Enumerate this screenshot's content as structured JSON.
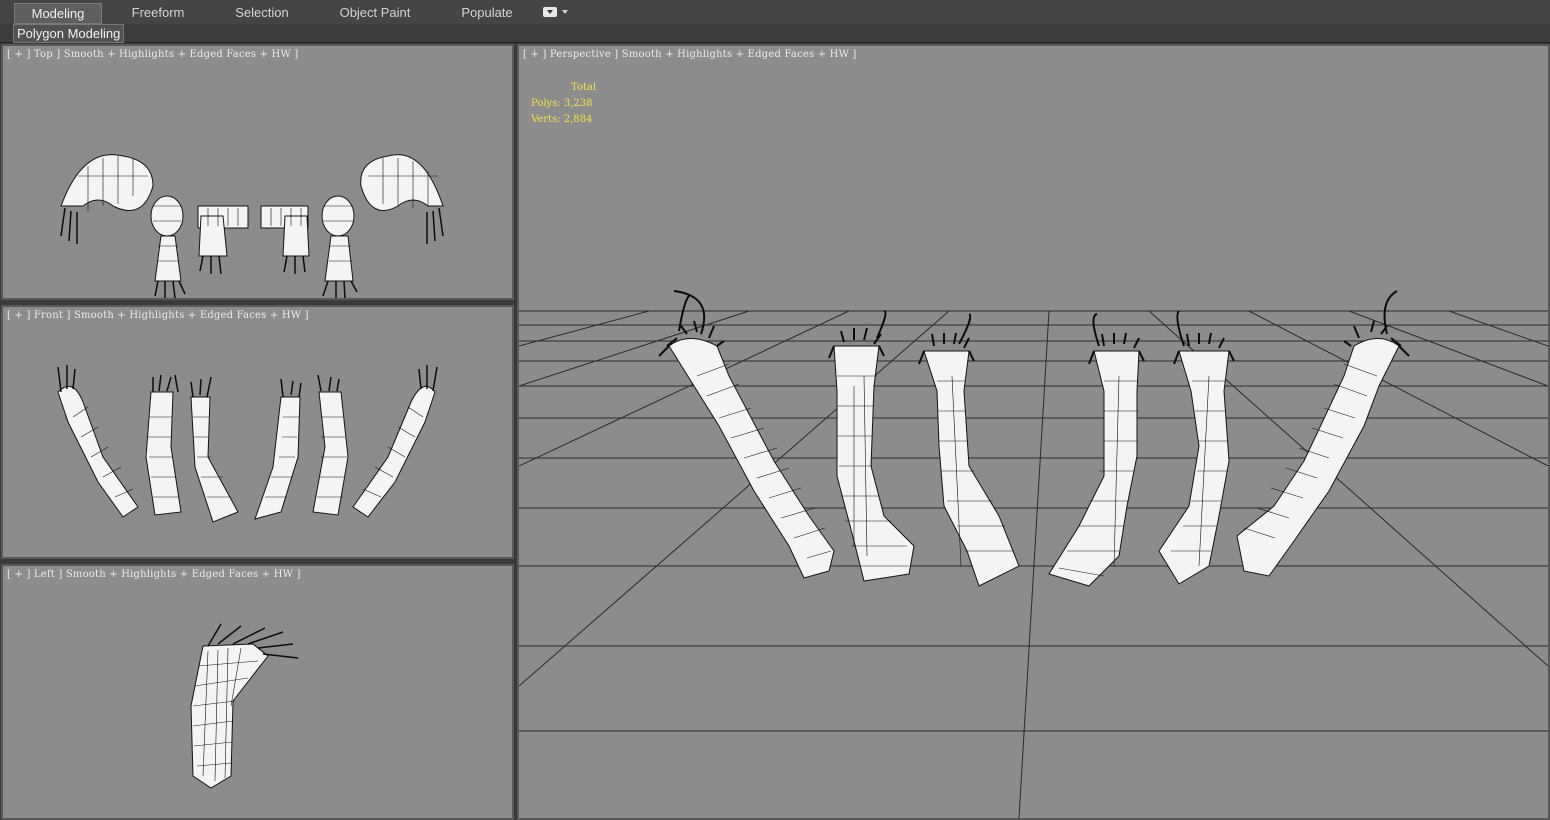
{
  "ribbon": {
    "tabs": [
      {
        "label": "Modeling",
        "active": true
      },
      {
        "label": "Freeform",
        "active": false
      },
      {
        "label": "Selection",
        "active": false
      },
      {
        "label": "Object Paint",
        "active": false
      },
      {
        "label": "Populate",
        "active": false
      }
    ],
    "dropdown_icon": "ribbon-options-icon"
  },
  "panel": {
    "label": "Polygon Modeling"
  },
  "viewports": {
    "top": {
      "label": "[ + ] Top ] Smooth + Highlights + Edged Faces + HW ]"
    },
    "front": {
      "label": "[ + ] Front ] Smooth + Highlights + Edged Faces + HW ]"
    },
    "left": {
      "label": "[ + ] Left ] Smooth + Highlights + Edged Faces + HW ]"
    },
    "perspective": {
      "label": "[ + ] Perspective ] Smooth + Highlights + Edged Faces + HW ]",
      "stats": {
        "total_label": "Total",
        "polys": "Polys: 3,238",
        "verts": "Verts: 2,884"
      }
    }
  },
  "colors": {
    "viewport_bg": "#8c8c8c",
    "stats_text": "#f2e14a",
    "mesh_fill": "#f4f4f4",
    "wire": "#141414"
  }
}
